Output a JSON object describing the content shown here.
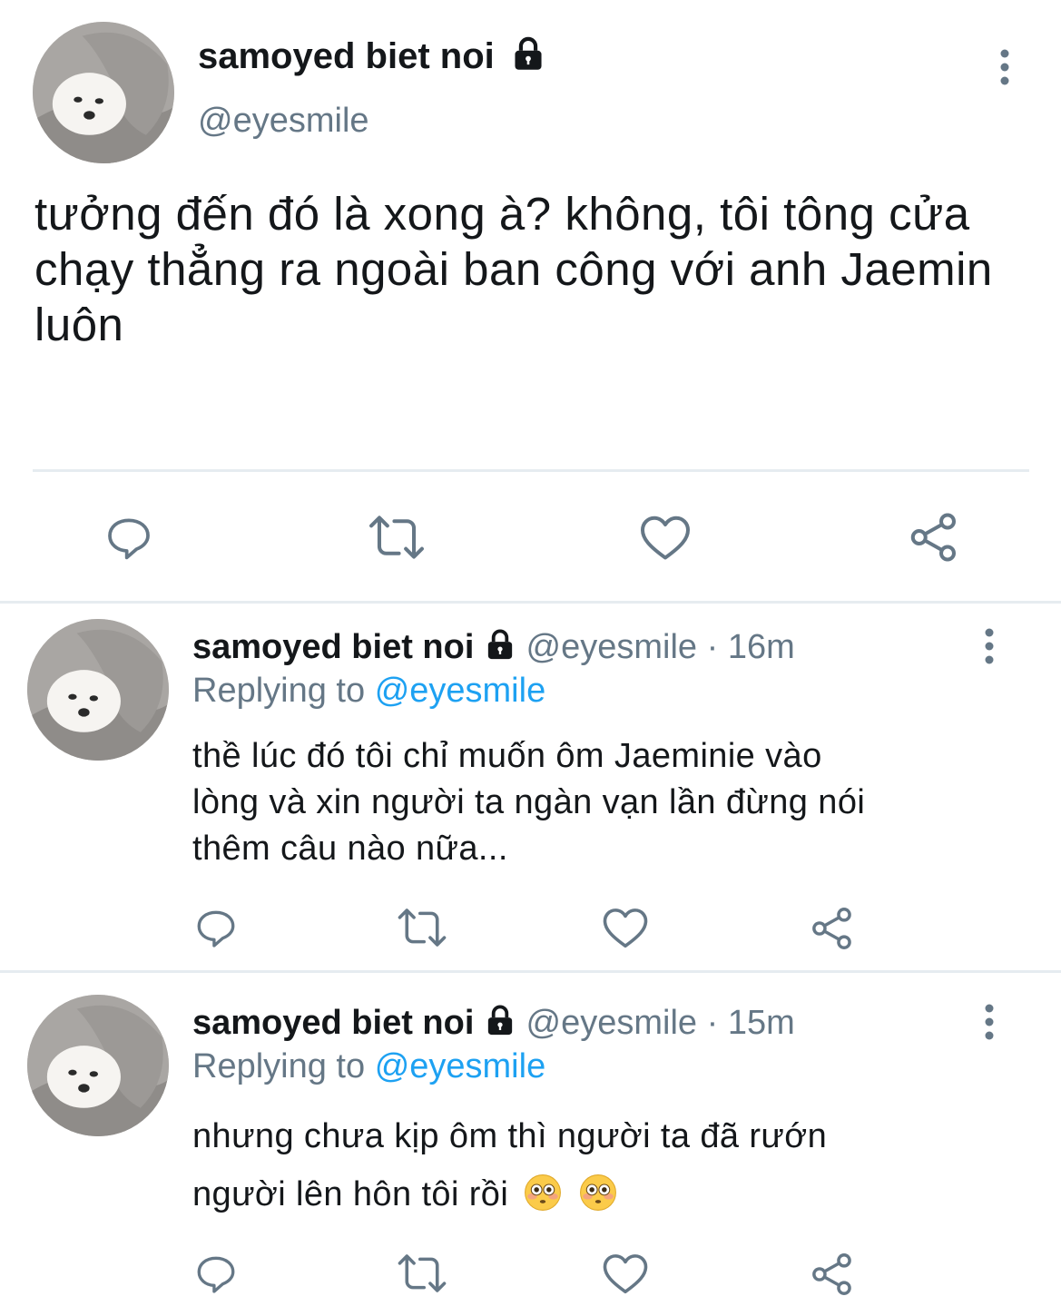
{
  "main_tweet": {
    "author_name": "samoyed biet noi",
    "handle": "@eyesmile",
    "text": "tưởng đến đó là xong à? không, tôi tông cửa chạy thẳng ra ngoài ban công với anh Jaemin luôn"
  },
  "replies": [
    {
      "author_name": "samoyed biet noi",
      "handle": "@eyesmile",
      "time": "· 16m",
      "replying_prefix": "Replying to",
      "replying_to": "@eyesmile",
      "text_lines": [
        "thề lúc đó tôi chỉ muốn ôm Jaeminie vào",
        "lòng và xin người ta ngàn vạn lần đừng nói",
        "thêm câu nào nữa..."
      ]
    },
    {
      "author_name": "samoyed biet noi",
      "handle": "@eyesmile",
      "time": "· 15m",
      "replying_prefix": "Replying to",
      "replying_to": "@eyesmile",
      "text_lines": [
        "nhưng chưa kịp ôm thì người ta đã rướn",
        "người lên hôn tôi rồi"
      ]
    }
  ],
  "colors": {
    "text": "#14171a",
    "secondary": "#657786",
    "link": "#1da1f2",
    "divider": "#e6ecf0"
  }
}
